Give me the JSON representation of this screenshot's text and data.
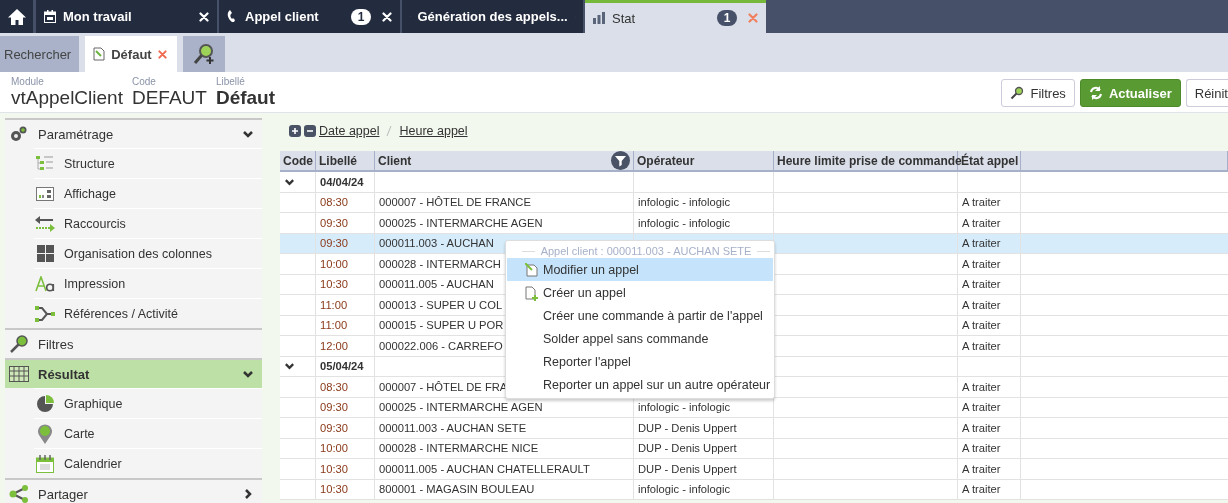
{
  "tabs": [
    {
      "label": "Mon travail",
      "selected": false
    },
    {
      "label": "Appel client",
      "badge": "1",
      "selected": false
    },
    {
      "label": "Génération des appels...",
      "selected": false
    },
    {
      "label": "Stat",
      "badge": "1",
      "selected": true
    }
  ],
  "subtabs": [
    {
      "label": "Rechercher",
      "selected": false
    },
    {
      "label": "Défaut",
      "selected": true
    }
  ],
  "header": {
    "fields": [
      {
        "label": "Module",
        "value": "vtAppelClient"
      },
      {
        "label": "Code",
        "value": "DEFAUT"
      },
      {
        "label": "Libellé",
        "value": "Défaut"
      }
    ],
    "buttons": [
      {
        "label": "Filtres",
        "kind": "filter"
      },
      {
        "label": "Actualiser",
        "kind": "primary"
      },
      {
        "label": "Réinit",
        "kind": "plain"
      }
    ]
  },
  "sidebar": {
    "items": [
      {
        "label": "Paramétrage",
        "expanded": true,
        "selected": false,
        "children": [
          {
            "label": "Structure"
          },
          {
            "label": "Affichage"
          },
          {
            "label": "Raccourcis"
          },
          {
            "label": "Organisation des colonnes"
          },
          {
            "label": "Impression"
          },
          {
            "label": "Références / Activité"
          }
        ]
      },
      {
        "label": "Filtres",
        "selected": false
      },
      {
        "label": "Résultat",
        "expanded": true,
        "selected": true,
        "children": [
          {
            "label": "Graphique"
          },
          {
            "label": "Carte"
          },
          {
            "label": "Calendrier"
          }
        ]
      },
      {
        "label": "Partager",
        "expanded": false,
        "selected": false
      }
    ]
  },
  "grouping": [
    "Date appel",
    "Heure appel"
  ],
  "table": {
    "columns": [
      "Code",
      "Libellé",
      "Client",
      "Opérateur",
      "Heure limite prise de commande",
      "État appel"
    ],
    "groups": [
      {
        "label": "04/04/24",
        "expanded": true,
        "rows": [
          {
            "time": "08:30",
            "client": "000007 - HÔTEL DE FRANCE",
            "operator": "infologic - infologic",
            "state": "A traiter",
            "selected": false
          },
          {
            "time": "09:30",
            "client": "000025 - INTERMARCHE AGEN",
            "operator": "infologic - infologic",
            "state": "A traiter",
            "selected": false
          },
          {
            "time": "09:30",
            "client": "000011.003 - AUCHAN",
            "state": "A traiter",
            "selected": true
          },
          {
            "time": "10:00",
            "client": "000028 - INTERMARCH",
            "state": "A traiter",
            "selected": false
          },
          {
            "time": "10:30",
            "client": "000011.005 - AUCHAN",
            "state": "A traiter",
            "selected": false
          },
          {
            "time": "11:00",
            "client": "000013 - SUPER U COL",
            "state": "A traiter",
            "selected": false
          },
          {
            "time": "11:00",
            "client": "000015 - SUPER U POR",
            "state": "A traiter",
            "selected": false
          },
          {
            "time": "12:00",
            "client": "000022.006 - CARREFO",
            "state": "A traiter",
            "selected": false
          }
        ]
      },
      {
        "label": "05/04/24",
        "expanded": true,
        "rows": [
          {
            "time": "08:30",
            "client": "000007 - HÔTEL DE FRA",
            "state": "A traiter",
            "selected": false
          },
          {
            "time": "09:30",
            "client": "000025 - INTERMARCHE AGEN",
            "operator": "infologic - infologic",
            "state": "A traiter",
            "selected": false
          },
          {
            "time": "09:30",
            "client": "000011.003 - AUCHAN SETE",
            "operator": "DUP - Denis Uppert",
            "state": "A traiter",
            "selected": false
          },
          {
            "time": "10:00",
            "client": "000028 - INTERMARCHE NICE",
            "operator": "DUP - Denis Uppert",
            "state": "A traiter",
            "selected": false
          },
          {
            "time": "10:30",
            "client": "000011.005 - AUCHAN CHATELLERAULT",
            "operator": "DUP - Denis Uppert",
            "state": "A traiter",
            "selected": false
          },
          {
            "time": "10:30",
            "client": "800001 - MAGASIN BOULEAU",
            "operator": "infologic - infologic",
            "state": "A traiter",
            "selected": false
          }
        ]
      }
    ]
  },
  "context_menu": {
    "title": "Appel client : 000011.003 - AUCHAN SETE",
    "items": [
      {
        "label": "Modifier un appel",
        "selected": true
      },
      {
        "label": "Créer un appel",
        "selected": false
      },
      {
        "label": "Créer une commande à partir de l'appel",
        "selected": false
      },
      {
        "label": "Solder appel sans commande",
        "selected": false
      },
      {
        "label": "Reporter l'appel",
        "selected": false
      },
      {
        "label": "Reporter un appel sur un autre opérateur",
        "selected": false
      }
    ]
  }
}
